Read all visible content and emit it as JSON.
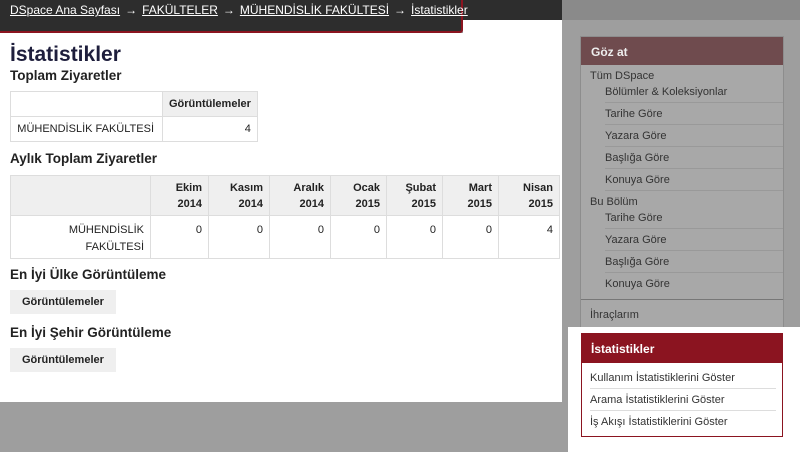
{
  "breadcrumb": {
    "items": [
      {
        "label": "DSpace Ana Sayfası",
        "link": true
      },
      {
        "label": "FAKÜLTELER",
        "link": true
      },
      {
        "label": "MÜHENDİSLİK FAKÜLTESİ",
        "link": true
      },
      {
        "label": "İstatistikler",
        "link": true
      }
    ],
    "separator": "→"
  },
  "page": {
    "title": "İstatistikler",
    "total_visits": {
      "heading": "Toplam Ziyaretler",
      "column_header": "Görüntülemeler",
      "row_label": "MÜHENDİSLİK FAKÜLTESİ",
      "value": "4"
    },
    "monthly_visits": {
      "heading": "Aylık Toplam Ziyaretler",
      "months": [
        {
          "month": "Ekim",
          "year": "2014"
        },
        {
          "month": "Kasım",
          "year": "2014"
        },
        {
          "month": "Aralık",
          "year": "2014"
        },
        {
          "month": "Ocak",
          "year": "2015"
        },
        {
          "month": "Şubat",
          "year": "2015"
        },
        {
          "month": "Mart",
          "year": "2015"
        },
        {
          "month": "Nisan",
          "year": "2015"
        }
      ],
      "row_label_line1": "MÜHENDİSLİK",
      "row_label_line2": "FAKÜLTESİ",
      "values": [
        "0",
        "0",
        "0",
        "0",
        "0",
        "0",
        "4"
      ]
    },
    "top_country": {
      "heading": "En İyi Ülke Görüntüleme",
      "column_header": "Görüntülemeler"
    },
    "top_city": {
      "heading": "En İyi Şehir Görüntüleme",
      "column_header": "Görüntülemeler"
    }
  },
  "sidebar": {
    "browse_header": "Göz at",
    "all_dspace": {
      "label": "Tüm DSpace",
      "items": [
        "Bölümler & Koleksiyonlar",
        "Tarihe Göre",
        "Yazara Göre",
        "Başlığa Göre",
        "Konuya Göre"
      ]
    },
    "this_section": {
      "label": "Bu Bölüm",
      "items": [
        "Tarihe Göre",
        "Yazara Göre",
        "Başlığa Göre",
        "Konuya Göre"
      ]
    },
    "exports": "İhraçlarım",
    "statistics": {
      "header": "İstatistikler",
      "items": [
        "Kullanım İstatistiklerini Göster",
        "Arama İstatistiklerini Göster",
        "İş Akışı İstatistiklerini Göster"
      ]
    }
  },
  "colors": {
    "accent": "#8b1420",
    "topbar": "#2d2d2d",
    "browse_header": "#6f4b4e"
  }
}
